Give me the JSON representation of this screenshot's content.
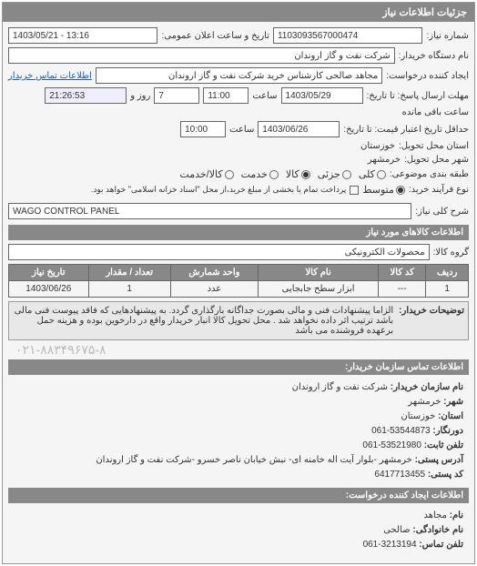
{
  "header": {
    "title": "جزئیات اطلاعات نیاز"
  },
  "fields": {
    "request_no_label": "شماره نیاز:",
    "request_no": "1103093567000474",
    "announce_label": "تاریخ و ساعت اعلان عمومی:",
    "announce_value": "1403/05/21 - 13:16",
    "buyer_label": "نام دستگاه خریدار:",
    "buyer_value": "شرکت نفت و گاز اروندان",
    "creator_label": "ایجاد کننده درخواست:",
    "creator_value": "مجاهد صالحی کارشناس خرید شرکت نفت و گاز اروندان",
    "buyer_contact_link": "اطلاعات تماس خریدار",
    "deadline_label": "مهلت ارسال پاسخ: تا تاریخ:",
    "deadline_date": "1403/05/29",
    "time_label": "ساعت",
    "deadline_time": "11:00",
    "days_remaining": "7",
    "days_label": "روز و",
    "time_remaining": "21:26:53",
    "time_remaining_label": "ساعت باقی مانده",
    "validity_label": "حداقل تاریخ اعتبار قیمت: تا تاریخ:",
    "validity_date": "1403/06/26",
    "validity_time": "10:00",
    "province_label": "استان محل تحویل:",
    "province_value": "خوزستان",
    "city_label": "شهر محل تحویل:",
    "city_value": "خرمشهر",
    "category_label": "طبقه بندی موضوعی:",
    "cat_all": "کلی",
    "cat_partial": "جزئی",
    "cat_goods": "کالا",
    "cat_service": "خدمت",
    "cat_goods_service": "کالا/خدمت",
    "process_label": "نوع فرآیند خرید:",
    "process_medium": "متوسط",
    "process_note": "پرداخت تمام یا بخشی از مبلغ خرید،از محل \"اسناد خزانه اسلامی\" خواهد بود.",
    "desc_label": "شرح کلی نیاز:",
    "desc_value": "WAGO CONTROL PANEL",
    "items_title": "اطلاعات کالاهای مورد نیاز",
    "group_label": "گروه کالا:",
    "group_value": "محصولات الکترونیکی"
  },
  "table": {
    "headers": [
      "ردیف",
      "کد کالا",
      "نام کالا",
      "واحد شمارش",
      "تعداد / مقدار",
      "تاریخ نیاز"
    ],
    "rows": [
      {
        "idx": "1",
        "code": "---",
        "name": "ابزار سطح جابجایی",
        "unit": "عدد",
        "qty": "1",
        "date": "1403/06/26"
      }
    ]
  },
  "note": {
    "label": "توضیحات خریدار:",
    "text": "الزاما پیشنهادات فنی و مالی بصورت جداگانه بارگذاری گردد. به پیشنهادهایی که فاقد پیوست فنی مالی باشد ترتیب اثر داده نخواهد شد . محل تحویل کالا انبار خریدار واقع در دارخوین بوده و هزینه حمل برعهده فروشنده می باشد"
  },
  "stamp": "۰۲۱-۸۸۳۴۹۶۷۵-۸",
  "footer": {
    "title": "اطلاعات تماس سازمان خریدار:",
    "org_label": "نام سازمان خریدار:",
    "org_value": "شرکت نفت و گاز اروندان",
    "city_label": "شهر:",
    "city_value": "خرمشهر",
    "province_label": "استان:",
    "province_value": "خوزستان",
    "fax_label": "دورنگار:",
    "fax_value": "061-53544873",
    "phone_label": "تلفن ثابت:",
    "phone_value": "061-53521980",
    "address_label": "آدرس پستی:",
    "address_value": "خرمشهر -بلوار آیت اله خامنه ای- نبش خیابان ناصر خسرو -شرکت نفت و گاز اروندان",
    "postal_label": "کد پستی:",
    "postal_value": "6417713455",
    "creator_title": "اطلاعات ایجاد کننده درخواست:",
    "name_label": "نام:",
    "name_value": "مجاهد",
    "surname_label": "نام خانوادگی:",
    "surname_value": "صالحی",
    "contact_phone_label": "تلفن تماس:",
    "contact_phone_value": "061-3213194"
  }
}
